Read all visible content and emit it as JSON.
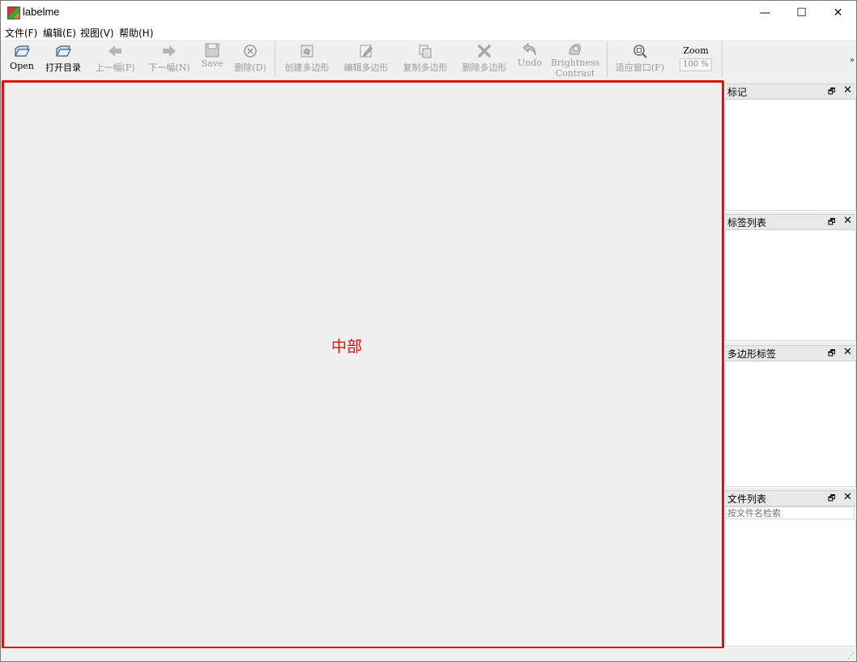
{
  "window": {
    "title": "labelme"
  },
  "titlebar": {
    "min": "—",
    "max": "☐",
    "close": "✕"
  },
  "menu": [
    "文件(F)",
    "编辑(E)",
    "视图(V)",
    "帮助(H)"
  ],
  "toolbar": {
    "open": "Open",
    "open_dir": "打开目录",
    "prev": "上一幅(P)",
    "next": "下一幅(N)",
    "save": "Save",
    "delete": "删除(D)",
    "create_polygon": "创建多边形",
    "edit_polygon": "编辑多边形",
    "copy_polygon": "复制多边形",
    "delete_polygon": "删除多边形",
    "undo": "Undo",
    "brightness": "Brightness",
    "contrast": "Contrast",
    "fit_window": "适应窗口(F)",
    "zoom_label": "Zoom",
    "zoom_value": "100 %",
    "overflow": "»"
  },
  "canvas": {
    "center_label": "中部"
  },
  "docks": {
    "flags": {
      "title": "标记"
    },
    "label_list": {
      "title": "标签列表"
    },
    "polygon_labels": {
      "title": "多边形标签"
    },
    "file_list": {
      "title": "文件列表",
      "search_placeholder": "按文件名检索"
    },
    "float_icon": "🗗",
    "close_icon": "✕"
  },
  "colors": {
    "accent_red": "#e01010"
  }
}
